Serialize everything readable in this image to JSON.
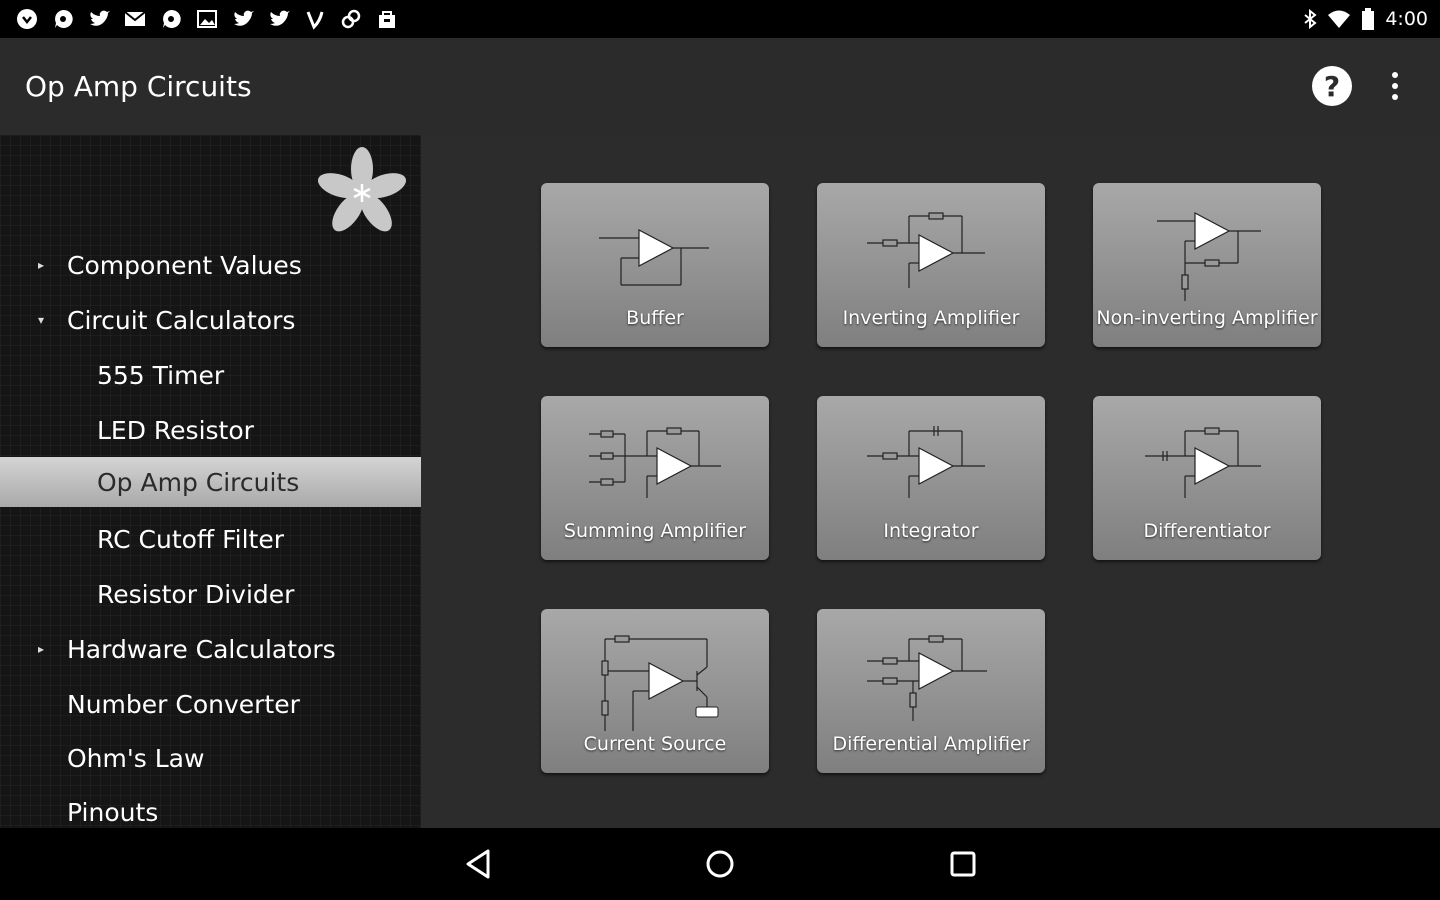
{
  "status_bar": {
    "time": "4:00",
    "notification_icons": [
      "pinterest-icon",
      "chat-icon",
      "twitter-icon",
      "gmail-icon",
      "chat-icon",
      "image-icon",
      "twitter-icon",
      "twitter-icon",
      "vine-icon",
      "link-icon",
      "bag-icon"
    ]
  },
  "app_bar": {
    "title": "Op Amp Circuits",
    "help_label": "?"
  },
  "sidebar": {
    "items": [
      {
        "label": "Component Values",
        "level": 1,
        "caret": "▸"
      },
      {
        "label": "Circuit Calculators",
        "level": 1,
        "caret": "▾"
      },
      {
        "label": "555 Timer",
        "level": 2
      },
      {
        "label": "LED Resistor",
        "level": 2
      },
      {
        "label": "Op Amp Circuits",
        "level": 2,
        "selected": true
      },
      {
        "label": "RC Cutoff Filter",
        "level": 2
      },
      {
        "label": "Resistor Divider",
        "level": 2
      },
      {
        "label": "Hardware Calculators",
        "level": 1,
        "caret": "▸"
      },
      {
        "label": "Number Converter",
        "level": 1
      },
      {
        "label": "Ohm's Law",
        "level": 1
      },
      {
        "label": "Pinouts",
        "level": 1
      }
    ]
  },
  "tiles": [
    {
      "label": "Buffer"
    },
    {
      "label": "Inverting Amplifier"
    },
    {
      "label": "Non-inverting Amplifier"
    },
    {
      "label": "Summing Amplifier"
    },
    {
      "label": "Integrator"
    },
    {
      "label": "Differentiator"
    },
    {
      "label": "Current Source"
    },
    {
      "label": "Differential Amplifier"
    }
  ],
  "colors": {
    "app_bar": "#2b2b2b",
    "content_bg": "#2c2c2c",
    "tile": "#999999",
    "selected_item": "#c0c0c0"
  }
}
